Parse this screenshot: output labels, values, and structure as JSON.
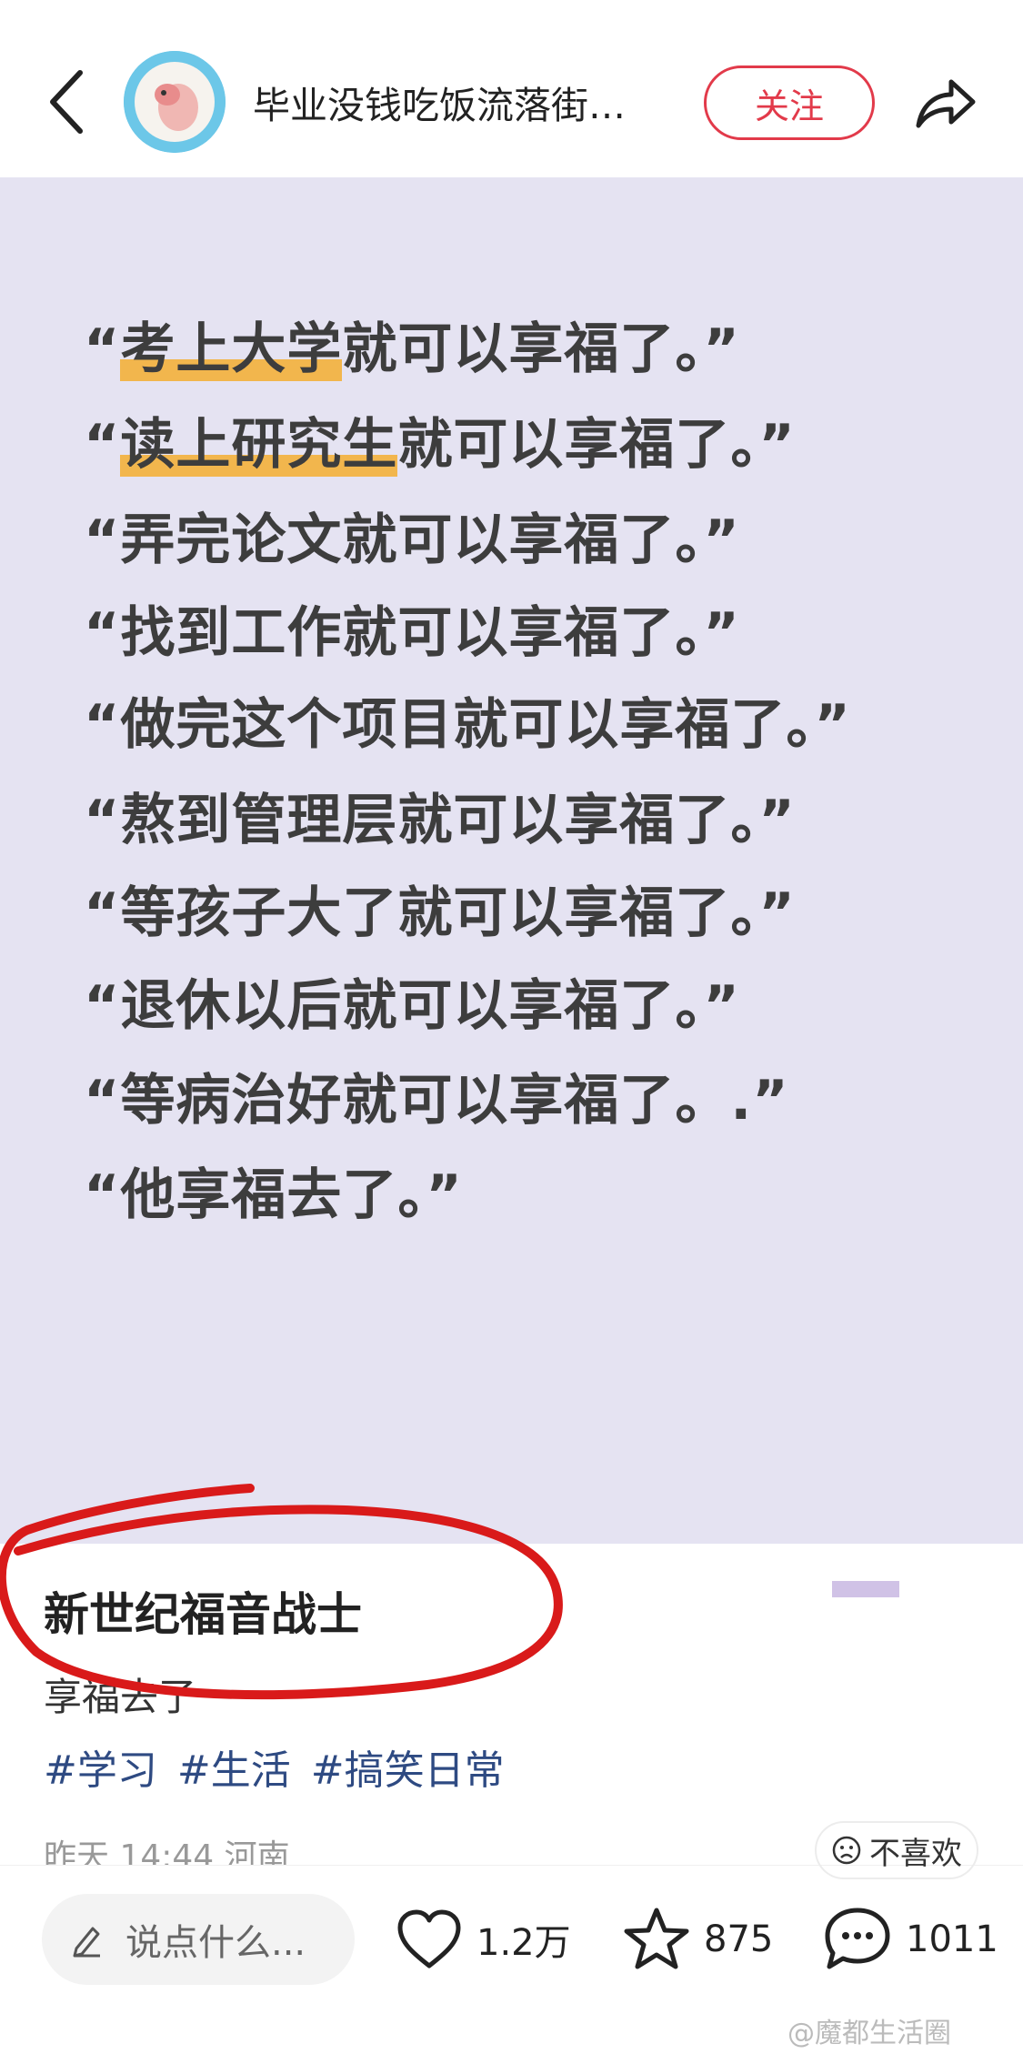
{
  "header": {
    "author_name": "毕业没钱吃饭流落街…",
    "follow_label": "关注",
    "icons": [
      "chevron-left-icon",
      "avatar",
      "share-icon"
    ]
  },
  "card": {
    "quotes": [
      {
        "pre": "“",
        "highlight": "考上大学",
        "rest": "就可以享福了。”"
      },
      {
        "pre": "“",
        "highlight": "读上研究生",
        "rest": "就可以享福了。”"
      },
      {
        "pre": "“",
        "highlight": "",
        "rest": "弄完论文就可以享福了。”"
      },
      {
        "pre": "“",
        "highlight": "",
        "rest": "找到工作就可以享福了。”"
      },
      {
        "pre": "“",
        "highlight": "",
        "rest": "做完这个项目就可以享福了。”"
      },
      {
        "pre": "“",
        "highlight": "",
        "rest": "熬到管理层就可以享福了。”"
      },
      {
        "pre": "“",
        "highlight": "",
        "rest": "等孩子大了就可以享福了。”"
      },
      {
        "pre": "“",
        "highlight": "",
        "rest": "退休以后就可以享福了。”"
      },
      {
        "pre": "“",
        "highlight": "",
        "rest": "等病治好就可以享福了。.”"
      },
      {
        "pre": "“",
        "highlight": "",
        "rest": "他享福去了。”"
      }
    ],
    "background_color": "#e5e3f2",
    "highlight_color": "#f2b64d"
  },
  "post": {
    "title": "新世纪福音战士",
    "body": "享福去了",
    "tags": [
      "#学习",
      "#生活",
      "#搞笑日常"
    ],
    "meta": "昨天 14:44 河南",
    "dislike_label": "不喜欢"
  },
  "bottom_bar": {
    "comment_placeholder": "说点什么...",
    "likes": "1.2万",
    "favorites": "875",
    "comments": "1011"
  },
  "annotation_color": "#d91a1a",
  "watermark": "@魔都生活圈"
}
